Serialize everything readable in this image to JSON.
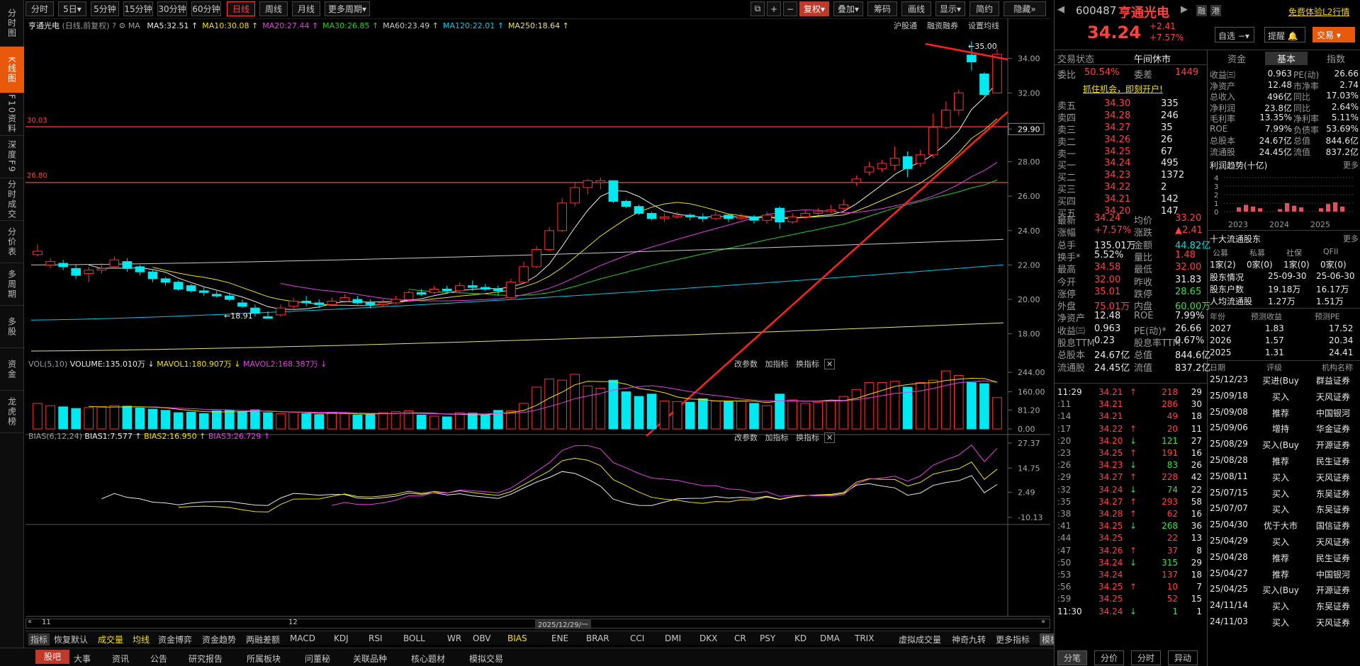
{
  "left_nav": [
    "分时图",
    "K线图",
    "F10资料",
    "深度F9",
    "分时成交",
    "分价表",
    "多周期",
    "多股",
    "资金",
    "龙虎榜"
  ],
  "toolbar": {
    "periods": [
      "分时",
      "5日",
      "5分钟",
      "15分钟",
      "30分钟",
      "60分钟",
      "日线",
      "周线",
      "月线",
      "更多周期"
    ],
    "active": "日线",
    "right": [
      "复权",
      "叠加",
      "筹码",
      "画线",
      "显示",
      "简约",
      "隐藏"
    ]
  },
  "chart": {
    "stock_title": "亨通光电",
    "mode": "(日线,前复权)",
    "ma": [
      {
        "label": "MA5:32.51",
        "color": "#e8e8e8"
      },
      {
        "label": "MA10:30.08",
        "color": "#f0e000"
      },
      {
        "label": "MA20:27.44",
        "color": "#e040e0"
      },
      {
        "label": "MA30:26.85",
        "color": "#20d020"
      },
      {
        "label": "MA60:23.49",
        "color": "#c8c8c8"
      },
      {
        "label": "MA120:22.01",
        "color": "#00c8e8"
      },
      {
        "label": "MA250:18.64",
        "color": "#e8e080"
      }
    ],
    "links": [
      "沪股通",
      "融资融券",
      "设置均线"
    ],
    "price_ticks": [
      "34.00",
      "32.00",
      "29.90",
      "28.00",
      "26.00",
      "24.00",
      "22.00",
      "20.00",
      "18.00"
    ],
    "hlines": [
      "30.03",
      "26.80"
    ],
    "high_label": "35.00",
    "low_label": "18.91",
    "vol_header": {
      "name": "VOL(5,10)",
      "volume": "VOLUME:135.010万",
      "mavol1": "MAVOL1:180.907万",
      "mavol2": "MAVOL2:168.387万"
    },
    "vol_ticks": [
      "244.00",
      "160.00",
      "81.20",
      "0.00"
    ],
    "bias_header": {
      "name": "BIAS(6,12,24)",
      "b1": "BIAS1:7.577",
      "b2": "BIAS2:16.950",
      "b3": "BIAS3:26.729"
    },
    "bias_ticks": [
      "27.37",
      "14.75",
      "2.49",
      "-10.13"
    ],
    "panel_btns": [
      "改参数",
      "加指标",
      "换指标"
    ],
    "x_labels": [
      "11",
      "12"
    ],
    "cursor_date": "2025/12/29/一"
  },
  "chart_data": {
    "type": "candlestick",
    "ma_values": {
      "MA5": 32.51,
      "MA10": 30.08,
      "MA20": 27.44,
      "MA30": 26.85,
      "MA60": 23.49,
      "MA120": 22.01,
      "MA250": 18.64
    },
    "last": {
      "open": 32.0,
      "high": 34.58,
      "low": 32.0,
      "close": 34.24,
      "volume_wan": 135.01
    },
    "hlines": [
      30.03,
      26.8
    ],
    "extremes": {
      "high": 35.0,
      "low": 18.91
    },
    "ylim": [
      17.0,
      36.0
    ]
  },
  "indicator_bar": [
    "指标",
    "恢复默认",
    "成交量",
    "均线",
    "资金博弈",
    "资金趋势",
    "两融差额",
    "MACD",
    "KDJ",
    "RSI",
    "BOLL",
    "WR",
    "OBV",
    "BIAS",
    "ENE",
    "BRAR",
    "CCI",
    "DMI",
    "DKX",
    "CR",
    "PSY",
    "KD",
    "DMA",
    "TRIX",
    "虚拟成交量",
    "神奇九转",
    "更多指标",
    "模板"
  ],
  "bottom_tabs": [
    "股吧",
    "大事",
    "资讯",
    "公告",
    "研究报告",
    "所属板块",
    "问董秘",
    "关联品种",
    "核心题材",
    "模拟交易"
  ],
  "right": {
    "code": "600487",
    "name": "亨通光电",
    "badges": [
      "融",
      "港"
    ],
    "promo": "免费体验L2行情",
    "price": "34.24",
    "chg": "+2.41",
    "pct": "+7.57%",
    "btns": [
      "自选",
      "提醒",
      "交易"
    ],
    "trade_status_label": "交易状态",
    "trade_status": "午间休市",
    "webi": "委比",
    "webi_v": "50.54%",
    "weicha": "委差",
    "weicha_v": "1449",
    "promo2": "抓住机会，即刻开户!",
    "asks": [
      [
        "卖五",
        "34.30",
        "335"
      ],
      [
        "卖四",
        "34.28",
        "246"
      ],
      [
        "卖三",
        "34.27",
        "35"
      ],
      [
        "卖二",
        "34.26",
        "26"
      ],
      [
        "卖一",
        "34.25",
        "67"
      ]
    ],
    "bids": [
      [
        "买一",
        "34.24",
        "495"
      ],
      [
        "买二",
        "34.23",
        "1372"
      ],
      [
        "买三",
        "34.22",
        "2"
      ],
      [
        "买四",
        "34.21",
        "142"
      ],
      [
        "买五",
        "34.20",
        "147"
      ]
    ],
    "stats": [
      [
        "最新",
        "34.24",
        "均价",
        "33.20"
      ],
      [
        "涨幅",
        "+7.57%",
        "涨跌",
        "▲2.41"
      ],
      [
        "总手",
        "135.01万",
        "金额",
        "44.82亿"
      ],
      [
        "换手*",
        "5.52%",
        "量比",
        "1.48"
      ],
      [
        "最高",
        "34.58",
        "最低",
        "32.00"
      ],
      [
        "今开",
        "32.00",
        "昨收",
        "31.83"
      ],
      [
        "涨停",
        "35.01",
        "跌停",
        "28.65"
      ],
      [
        "外盘",
        "75.01万",
        "内盘",
        "60.00万"
      ],
      [
        "净资产",
        "12.48",
        "ROE",
        "7.99%"
      ],
      [
        "收益㈢",
        "0.963",
        "PE(动)*",
        "26.66"
      ],
      [
        "股息TTM",
        "0.23",
        "股息率TTM",
        "0.67%"
      ],
      [
        "总股本",
        "24.67亿",
        "总值",
        "844.6亿"
      ],
      [
        "流通股",
        "24.45亿",
        "流值",
        "837.2亿"
      ]
    ],
    "ticks": [
      [
        "11:29",
        "34.21",
        "↑",
        "218",
        "29"
      ],
      [
        ":11",
        "34.21",
        "",
        "286",
        "30"
      ],
      [
        ":14",
        "34.21",
        "",
        "49",
        "18"
      ],
      [
        ":17",
        "34.22",
        "↑",
        "20",
        "11"
      ],
      [
        ":20",
        "34.20",
        "↓",
        "121",
        "27"
      ],
      [
        ":23",
        "34.25",
        "↑",
        "191",
        "16"
      ],
      [
        ":26",
        "34.23",
        "↓",
        "83",
        "26"
      ],
      [
        ":29",
        "34.27",
        "↑",
        "228",
        "42"
      ],
      [
        ":32",
        "34.24",
        "↓",
        "74",
        "22"
      ],
      [
        ":35",
        "34.27",
        "↑",
        "293",
        "58"
      ],
      [
        ":38",
        "34.28",
        "↑",
        "62",
        "16"
      ],
      [
        ":41",
        "34.25",
        "↓",
        "268",
        "36"
      ],
      [
        ":44",
        "34.25",
        "",
        "22",
        "13"
      ],
      [
        ":47",
        "34.26",
        "↑",
        "37",
        "8"
      ],
      [
        ":50",
        "34.24",
        "↓",
        "315",
        "29"
      ],
      [
        ":53",
        "34.24",
        "",
        "137",
        "18"
      ],
      [
        ":56",
        "34.25",
        "↑",
        "10",
        "7"
      ],
      [
        ":59",
        "34.25",
        "",
        "52",
        "15"
      ],
      [
        "11:30",
        "34.24",
        "↓",
        "1",
        "1"
      ]
    ],
    "tick_tabs": [
      "分笔",
      "分价",
      "分时",
      "异动"
    ],
    "f10_tabs": [
      "资金",
      "基本",
      "指数"
    ],
    "basic": [
      [
        "收益㈢",
        "0.963",
        "PE(动)",
        "26.66"
      ],
      [
        "净资产",
        "12.48",
        "市净率",
        "2.74"
      ],
      [
        "总收入",
        "496亿",
        "同比",
        "17.03%"
      ],
      [
        "净利润",
        "23.8亿",
        "同比",
        "2.64%"
      ],
      [
        "毛利率",
        "13.35%",
        "净利率",
        "5.11%"
      ],
      [
        "ROE",
        "7.99%",
        "负债率",
        "53.69%"
      ],
      [
        "总股本",
        "24.67亿",
        "总值",
        "844.6亿"
      ],
      [
        "流通股",
        "24.45亿",
        "流值",
        "837.2亿"
      ]
    ],
    "profit_title": "利润趋势(十亿)",
    "more": "更多",
    "profit_axis": [
      "4",
      "3",
      "2",
      "1",
      "0"
    ],
    "profit_years": [
      "2023",
      "2024",
      "2025"
    ],
    "holders_title": "十大流通股东",
    "holders_cols": [
      "公募",
      "私募",
      "社保",
      "QFII"
    ],
    "holders_vals": [
      "1家(2)",
      "0家(0)",
      "1家(0)",
      "0家(0)"
    ],
    "holder_rows": [
      [
        "股东情况",
        "25-09-30",
        "25-06-30"
      ],
      [
        "股东户数",
        "19.18万",
        "16.17万"
      ],
      [
        "人均流通股",
        "1.27万",
        "1.51万"
      ]
    ],
    "forecast_cols": [
      "年份",
      "预测收益",
      "预测PE"
    ],
    "forecast": [
      [
        "2027",
        "1.83",
        "17.52"
      ],
      [
        "2026",
        "1.57",
        "20.34"
      ],
      [
        "2025",
        "1.31",
        "24.41"
      ]
    ],
    "rating_cols": [
      "日期",
      "评级",
      "机构名称"
    ],
    "ratings": [
      [
        "25/12/23",
        "买进(Buy",
        "群益证券"
      ],
      [
        "25/09/18",
        "买入",
        "天风证券"
      ],
      [
        "25/09/08",
        "推荐",
        "中国银河"
      ],
      [
        "25/09/06",
        "增持",
        "华金证券"
      ],
      [
        "25/08/29",
        "买入(Buy",
        "开源证券"
      ],
      [
        "25/08/28",
        "推荐",
        "民生证券"
      ],
      [
        "25/08/11",
        "买入",
        "天风证券"
      ],
      [
        "25/07/15",
        "买入",
        "东吴证券"
      ],
      [
        "25/07/07",
        "买入",
        "东吴证券"
      ],
      [
        "25/04/30",
        "优于大市",
        "国信证券"
      ],
      [
        "25/04/29",
        "买入",
        "天风证券"
      ],
      [
        "25/04/28",
        "推荐",
        "民生证券"
      ],
      [
        "25/04/27",
        "推荐",
        "中国银河"
      ],
      [
        "25/04/25",
        "买入(Buy",
        "开源证券"
      ],
      [
        "24/11/14",
        "买入",
        "东吴证券"
      ],
      [
        "24/11/03",
        "买入",
        "天风证券"
      ]
    ]
  }
}
